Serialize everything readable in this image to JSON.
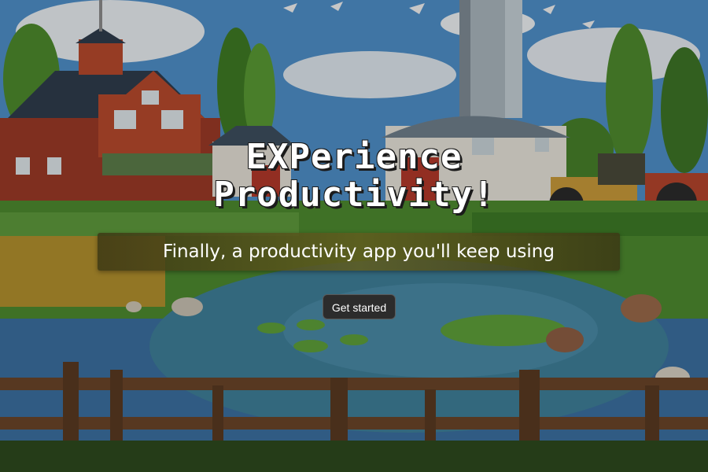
{
  "hero": {
    "title_line1": "EXPerience",
    "title_line2": "Productivity!",
    "subtitle": "Finally, a productivity app you'll keep using",
    "cta_label": "Get started"
  },
  "colors": {
    "sky": "#4f8fc9",
    "barn_red": "#b2442c",
    "roof_dark": "#2f3c4c",
    "grass": "#4d8a2f",
    "water": "#3f7f99",
    "fence": "#5a3a22",
    "cta_bg": "#2c2c2c"
  }
}
